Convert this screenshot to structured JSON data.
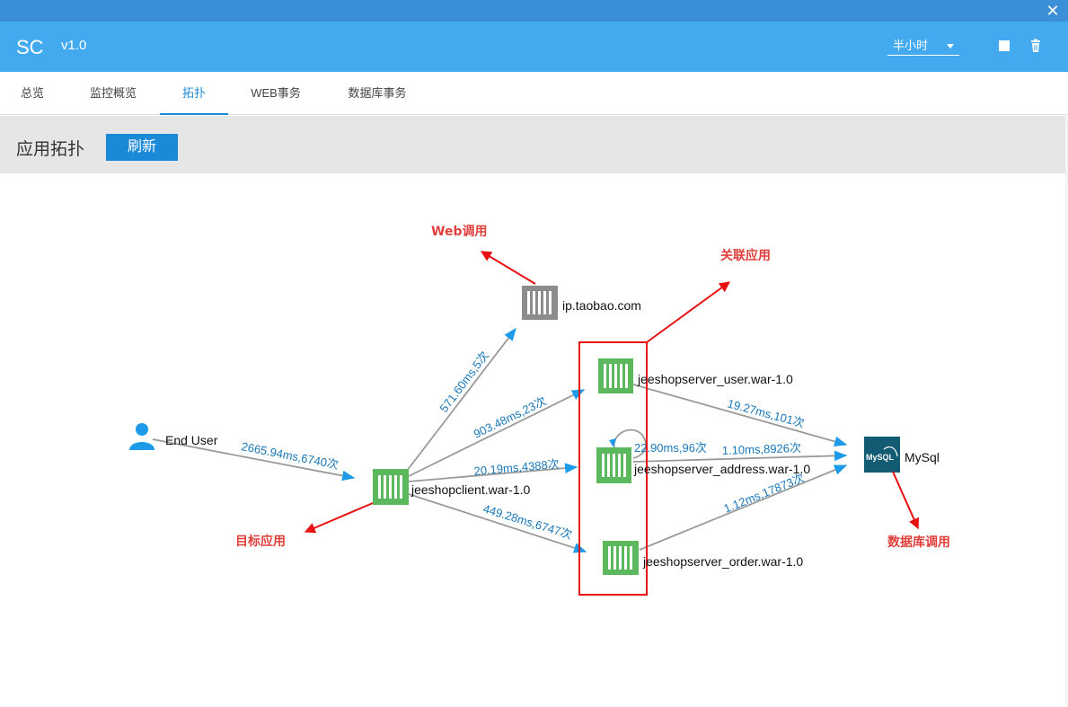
{
  "window": {
    "close_icon": "close-icon"
  },
  "header": {
    "app_name": "SC",
    "version": "v1.0",
    "time_range": "半小时",
    "stop_icon": "square-icon",
    "delete_icon": "trash-icon"
  },
  "tabs": [
    {
      "label": "总览"
    },
    {
      "label": "监控概览"
    },
    {
      "label": "拓扑",
      "active": true
    },
    {
      "label": "WEB事务"
    },
    {
      "label": "数据库事务"
    }
  ],
  "toolbar": {
    "title": "应用拓扑",
    "refresh_label": "刷新"
  },
  "colors": {
    "accent": "#1a8ad8",
    "appbar": "#44aaf0",
    "app_node": "#5cb85c",
    "external_node": "#8c8c8c",
    "db_node": "#135a73",
    "annotation": "#e0403c",
    "edge_label": "#1a78b8"
  },
  "topology": {
    "nodes": {
      "end_user": {
        "label": "End User",
        "icon": "user-icon"
      },
      "client": {
        "label": "jeeshopclient.war-1.0",
        "icon": "app-server-icon"
      },
      "taobao": {
        "label": "ip.taobao.com",
        "icon": "external-service-icon"
      },
      "user": {
        "label": "jeeshopserver_user.war-1.0",
        "icon": "app-server-icon"
      },
      "address": {
        "label": "jeeshopserver_address.war-1.0",
        "icon": "app-server-icon"
      },
      "order": {
        "label": "jeeshopserver_order.war-1.0",
        "icon": "app-server-icon"
      },
      "mysql": {
        "label": "MySql",
        "icon": "mysql-icon",
        "logo_text": "MySQL"
      }
    },
    "edges": {
      "enduser_client": "2665.94ms,6740次",
      "client_taobao": "571.60ms,5次",
      "client_user": "903.48ms,23次",
      "client_address": "20.19ms,4388次",
      "client_order": "449.28ms,6747次",
      "address_self": "22.90ms,96次",
      "user_mysql": "19.27ms,101次",
      "address_mysql": "1.10ms,8926次",
      "order_mysql": "1.12ms,17873次"
    }
  },
  "annotations": {
    "web_call": "Web调用",
    "related_apps": "关联应用",
    "target_app": "目标应用",
    "db_call": "数据库调用"
  }
}
